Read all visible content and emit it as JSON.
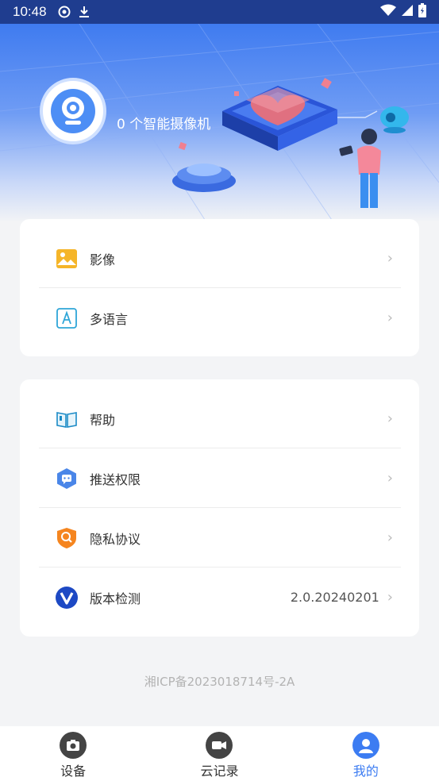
{
  "status_bar": {
    "time": "10:48"
  },
  "profile": {
    "name": "0 个智能摄像机"
  },
  "menu_group_1": [
    {
      "label": "影像",
      "icon": "image-icon"
    },
    {
      "label": "多语言",
      "icon": "language-icon"
    }
  ],
  "menu_group_2": [
    {
      "label": "帮助",
      "icon": "help-book-icon"
    },
    {
      "label": "推送权限",
      "icon": "push-permission-icon"
    },
    {
      "label": "隐私协议",
      "icon": "privacy-shield-icon"
    },
    {
      "label": "版本检测",
      "icon": "version-check-icon",
      "value": "2.0.20240201"
    }
  ],
  "footer": {
    "icp": "湘ICP备2023018714号-2A"
  },
  "bottom_nav": [
    {
      "label": "设备",
      "icon": "camera-icon",
      "active": false
    },
    {
      "label": "云记录",
      "icon": "video-icon",
      "active": false
    },
    {
      "label": "我的",
      "icon": "user-icon",
      "active": true
    }
  ],
  "colors": {
    "accent": "#3c7cf2",
    "status_bar": "#1f3d8f",
    "background": "#f3f4f6"
  }
}
